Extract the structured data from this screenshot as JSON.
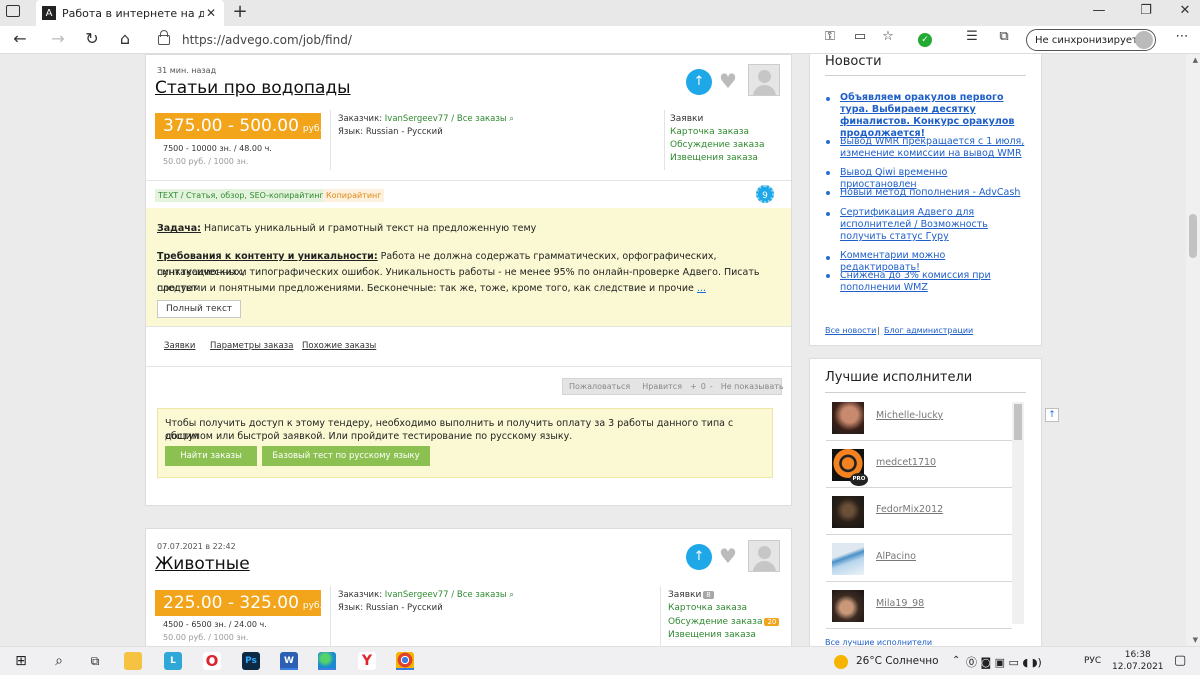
{
  "browser": {
    "tab_favicon": "A",
    "tab_title": "Работа в интернете на дому он",
    "url": "https://advego.com/job/find/",
    "sync_label": "Не синхронизируется"
  },
  "jobs": [
    {
      "posted": "31 мин. назад",
      "title": "Статьи про водопады",
      "price": "375.00 - 500.00",
      "currency": "руб.",
      "volume": "7500 - 10000 зн. / 48.00 ч.",
      "rate": "50.00 руб. / 1000 зн.",
      "customer_label": "Заказчик:",
      "customer_name": "IvanSergeev77",
      "all_orders": "/ Все заказы ⌕",
      "language": "Язык: Russian - Русский",
      "links": [
        "Заявки",
        "Карточка заказа",
        "Обсуждение заказа",
        "Извещения заказа"
      ],
      "tags": [
        "TEXT / Статья, обзор, SEO-копирайтинг",
        "Копирайтинг"
      ],
      "gear_count": "9",
      "task_label": "Задача:",
      "task_text": "Написать уникальный и грамотный текст на предложенную тему",
      "req_label": "Требования к контенту и уникальности:",
      "req_text_1": "Работа не должна содержать грамматических, орфографических, пунктуационных,",
      "req_text_2": "синтаксических и типографических ошибок. Уникальность работы - не менее 95% по онлайн-проверке Адвего. Писать следует",
      "req_text_3": "простыми и понятными предложениями. Бесконечные: так же, тоже, кроме того, как следствие и прочие",
      "more": "...",
      "fulltext_button": "Полный текст",
      "subtabs": [
        "Заявки",
        "Параметры заказа",
        "Похожие заказы"
      ],
      "actions": [
        "Пожаловаться",
        "Нравится",
        "+",
        "0",
        "-",
        "Не показывать"
      ],
      "notice_1": "Чтобы получить доступ к этому тендеру, необходимо выполнить и получить оплату за 3 работы данного типа с общим",
      "notice_2": "доступом или быстрой заявкой. Или пройдите тестирование по русскому языку.",
      "btn_find": "Найти заказы",
      "btn_test": "Базовый тест по русскому языку"
    },
    {
      "posted": "07.07.2021 в 22:42",
      "title": "Животные",
      "price": "225.00 - 325.00",
      "currency": "руб.",
      "volume": "4500 - 6500 зн. / 24.00 ч.",
      "rate": "50.00 руб. / 1000 зн.",
      "customer_label": "Заказчик:",
      "customer_name": "IvanSergeev77",
      "all_orders": "/ Все заказы ⌕",
      "language": "Язык: Russian - Русский",
      "link_applications": "Заявки",
      "applications_count": "8",
      "link_card": "Карточка заказа",
      "link_discussion": "Обсуждение заказа",
      "discussion_count": "20",
      "link_notices": "Извещения заказа"
    }
  ],
  "sidebar": {
    "news_title": "Новости",
    "news": [
      {
        "text": "Объявляем оракулов первого тура. Выбираем десятку финалистов. Конкурс оракулов продолжается!",
        "bold": true
      },
      {
        "text": "Вывод WMR прекращается с 1 июля, изменение комиссии на вывод WMR",
        "bold": false
      },
      {
        "text": "Вывод Qiwi временно приостановлен",
        "bold": false
      },
      {
        "text": "Новый метод пополнения - AdvCash",
        "bold": false
      },
      {
        "text": "Сертификация Адвего для исполнителей / Возможность получить статус Гуру",
        "bold": false
      },
      {
        "text": "Комментарии можно редактировать!",
        "bold": false
      },
      {
        "text": "Снижена до 3% комиссия при пополнении WMZ",
        "bold": false
      }
    ],
    "all_news": "Все новости",
    "sep": "|",
    "admin_blog": "Блог администрации",
    "best_title": "Лучшие исполнители",
    "performers": [
      "Michelle-lucky",
      "medcet1710",
      "FedorMix2012",
      "AlPacino",
      "Mila19_98"
    ],
    "pro_badge": "PRO",
    "all_best": "Все лучшие исполнители"
  },
  "taskbar": {
    "temperature": "26°C Солнечно",
    "lang": "РУС",
    "time": "16:38",
    "date": "12.07.2021"
  },
  "colors": {
    "price_orange": "#f2a51b",
    "accent_blue": "#1ea8e8",
    "button_green": "#8cc152",
    "notice_yellow": "#fbf9d3"
  }
}
